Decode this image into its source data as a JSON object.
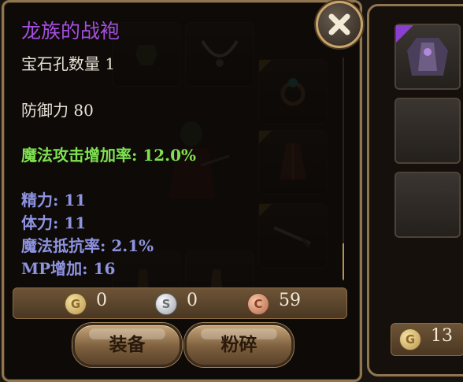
{
  "tooltip": {
    "item_name": "龙族的战袍",
    "gem_slots": "宝石孔数量 1",
    "defense": "防御力 80",
    "magic_attack_bonus": "魔法攻击增加率: 12.0%",
    "stats": [
      "精力: 11",
      "体力: 11",
      "魔法抵抗率: 2.1%",
      "MP增加: 16"
    ],
    "name_color": "#a54fe0",
    "bonus_color": "#7fe14f",
    "stat_color": "#8e93e0"
  },
  "currency": {
    "gold_letter": "G",
    "silver_letter": "S",
    "copper_letter": "C",
    "gold": "0",
    "silver": "0",
    "copper": "59"
  },
  "buttons": {
    "equip": "装备",
    "smash": "粉碎"
  },
  "right_panel": {
    "gold": "13"
  },
  "icons": [
    "close-icon",
    "gold-coin-icon",
    "silver-coin-icon",
    "copper-coin-icon",
    "armor-icon",
    "necklace-icon",
    "ring-icon",
    "robe-icon",
    "weapon-icon",
    "boots-icon"
  ]
}
